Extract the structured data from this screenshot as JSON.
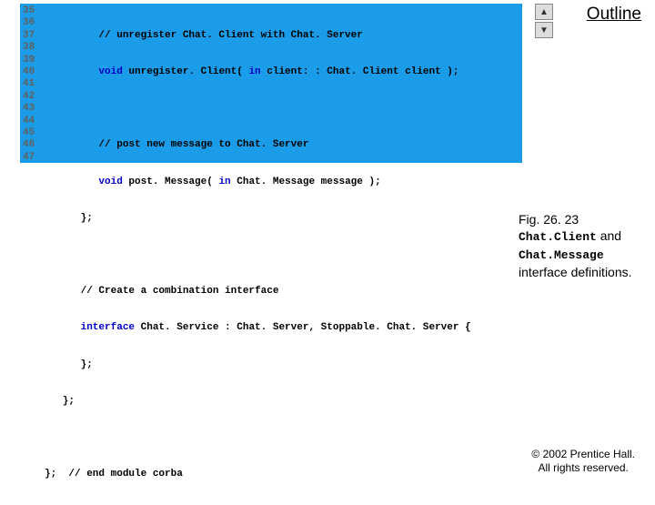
{
  "outline_label": "Outline",
  "line_numbers": [
    "35",
    "36",
    "37",
    "38",
    "39",
    "40",
    "41",
    "42",
    "43",
    "44",
    "45",
    "46",
    "47"
  ],
  "code": {
    "l35_a": "         // unregister Chat. Client with Chat. Server",
    "l36_a": "         ",
    "l36_kw1": "void",
    "l36_b": " unregister. Client( ",
    "l36_kw2": "in",
    "l36_c": " client: : Chat. Client client );",
    "l37": "",
    "l38": "         // post new message to Chat. Server",
    "l39_a": "         ",
    "l39_kw1": "void",
    "l39_b": " post. Message( ",
    "l39_kw2": "in",
    "l39_c": " Chat. Message message );",
    "l40": "      };",
    "l41": "",
    "l42": "      // Create a combination interface",
    "l43_a": "      ",
    "l43_kw1": "interface",
    "l43_b": " Chat. Service : Chat. Server, Stoppable. Chat. Server {",
    "l44": "      };",
    "l45": "   };",
    "l46": "",
    "l47": "};  // end module corba"
  },
  "caption": {
    "fig": "Fig. 26. 23",
    "c1": "Chat.Client",
    "and": "  and",
    "c2": "Chat.Message",
    "defs": "interface definitions."
  },
  "copyright": {
    "l1": "© 2002 Prentice Hall.",
    "l2": "All rights reserved."
  }
}
